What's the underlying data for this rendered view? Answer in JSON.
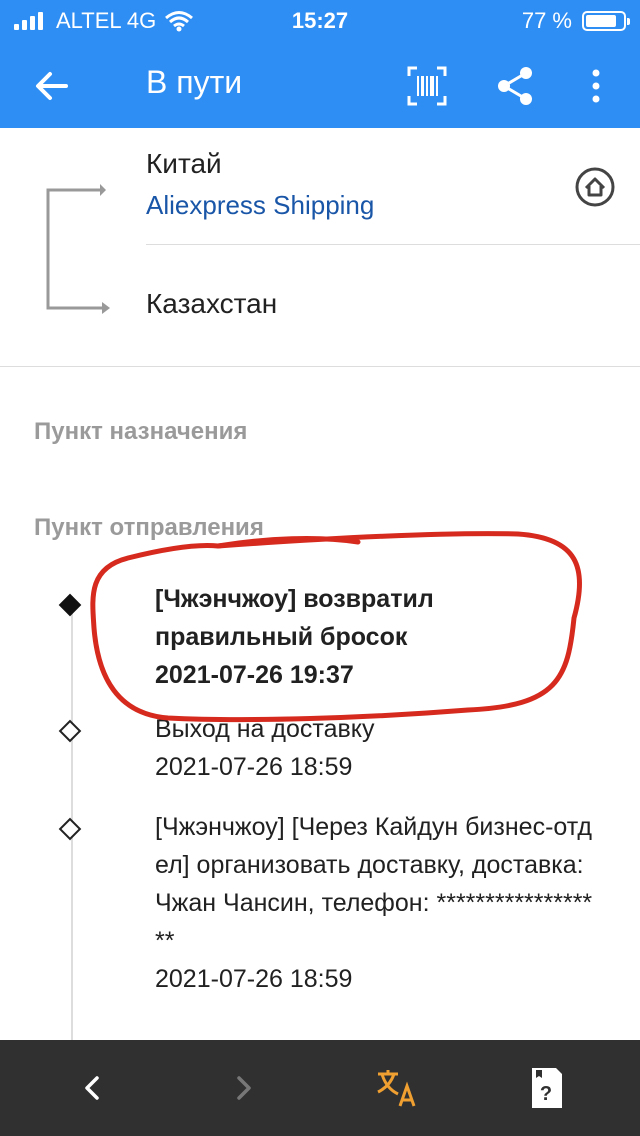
{
  "status_bar": {
    "carrier": "ALTEL 4G",
    "time": "15:27",
    "battery": "77 %"
  },
  "app_bar": {
    "title": "В пути",
    "icons": [
      "back-arrow-icon",
      "barcode-icon",
      "share-icon",
      "more-vert-icon"
    ]
  },
  "route": {
    "origin": "Китай",
    "carrier": "Aliexpress Shipping",
    "destination": "Казахстан"
  },
  "sections": {
    "destination_point": "Пункт назначения",
    "origin_point": "Пункт отправления"
  },
  "events": [
    {
      "text": "[Чжэнчжоу] возвратил правильный бросок",
      "time": "2021-07-26 19:37",
      "bold": true
    },
    {
      "text": "Выход на доставку",
      "time": "2021-07-26 18:59",
      "bold": false
    },
    {
      "text": "[Чжэнчжоу] [Через Кайдун бизнес-отдел] организовать доставку, доставка: Чжан Чансин, телефон: ******************",
      "time": "2021-07-26 18:59",
      "bold": false
    }
  ],
  "annotation_color": "#d62a1e",
  "colors": {
    "accent": "#2f8ef3",
    "link": "#1a56a8",
    "nav_bar": "#303030",
    "translate_icon": "#f0a030"
  },
  "bottom_nav": [
    "nav-back-icon",
    "nav-forward-icon",
    "translate-icon",
    "help-icon"
  ]
}
